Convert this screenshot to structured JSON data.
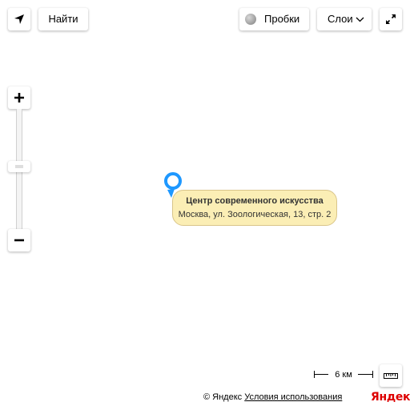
{
  "toolbar": {
    "search_label": "Найти",
    "traffic_label": "Пробки",
    "layers_label": "Слои"
  },
  "icons": {
    "geolocation": "arrow-navigation-icon",
    "traffic": "traffic-light-icon",
    "layers_dropdown": "chevron-down-icon",
    "fullscreen": "expand-icon",
    "zoom_in": "plus-icon",
    "zoom_out": "minus-icon",
    "ruler": "ruler-icon",
    "placemark": "map-pin-icon"
  },
  "zoom": {
    "level_fraction": 0.47
  },
  "placemark": {
    "title": "Центр современного искусства",
    "address": "Москва, ул. Зоологическая, 13, стр. 2"
  },
  "scale": {
    "label": "6 км"
  },
  "footer": {
    "copyright": "© Яндекс",
    "terms_link": "Условия использования",
    "logo_text": "Яндекс"
  },
  "colors": {
    "balloon_bg": "#fbeeb5",
    "balloon_border": "#d9c58a",
    "placemark": "#1e98ff",
    "logo": "#dd0000"
  }
}
